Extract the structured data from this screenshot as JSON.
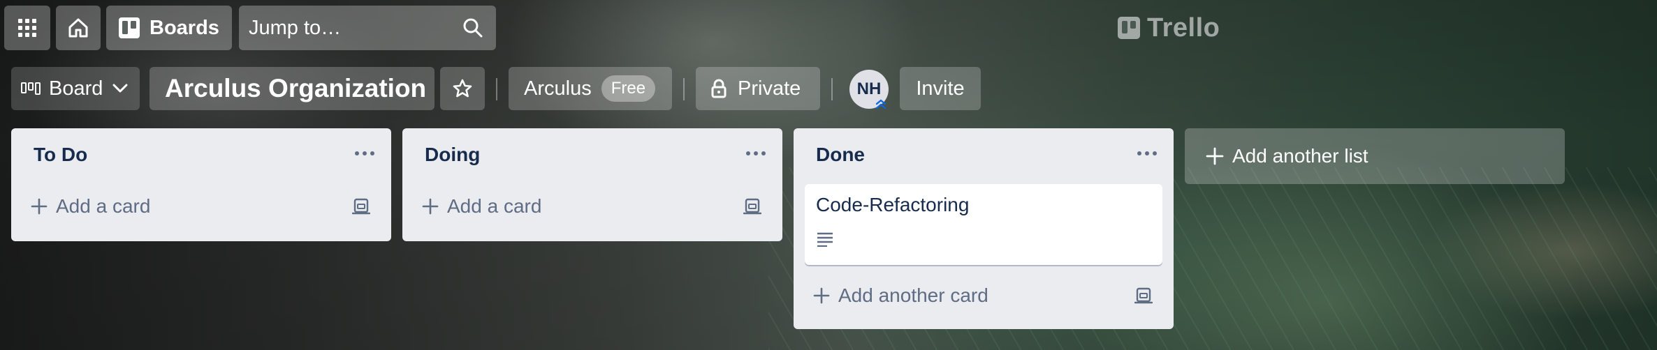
{
  "header": {
    "boards_label": "Boards",
    "search_placeholder": "Jump to…",
    "logo_text": "Trello"
  },
  "board_bar": {
    "view_label": "Board",
    "board_title": "Arculus Organization",
    "workspace_name": "Arculus",
    "workspace_badge": "Free",
    "visibility_label": "Private",
    "member_initials": "NH",
    "invite_label": "Invite"
  },
  "lists": [
    {
      "title": "To Do",
      "cards": [],
      "add_card_label": "Add a card"
    },
    {
      "title": "Doing",
      "cards": [],
      "add_card_label": "Add a card"
    },
    {
      "title": "Done",
      "cards": [
        {
          "title": "Code-Refactoring",
          "has_description": true
        }
      ],
      "add_card_label": "Add another card"
    }
  ],
  "add_list_label": "Add another list",
  "colors": {
    "list_bg": "#ebecf0",
    "text_primary": "#172b4d",
    "text_muted": "#5e6c84",
    "card_bg": "#ffffff"
  },
  "icons": [
    "apps-grid-icon",
    "home-icon",
    "boards-icon",
    "search-icon",
    "board-view-icon",
    "chevron-down-icon",
    "star-icon",
    "lock-icon",
    "admin-chevron-icon",
    "list-menu-icon",
    "plus-icon",
    "card-template-icon",
    "description-icon"
  ]
}
